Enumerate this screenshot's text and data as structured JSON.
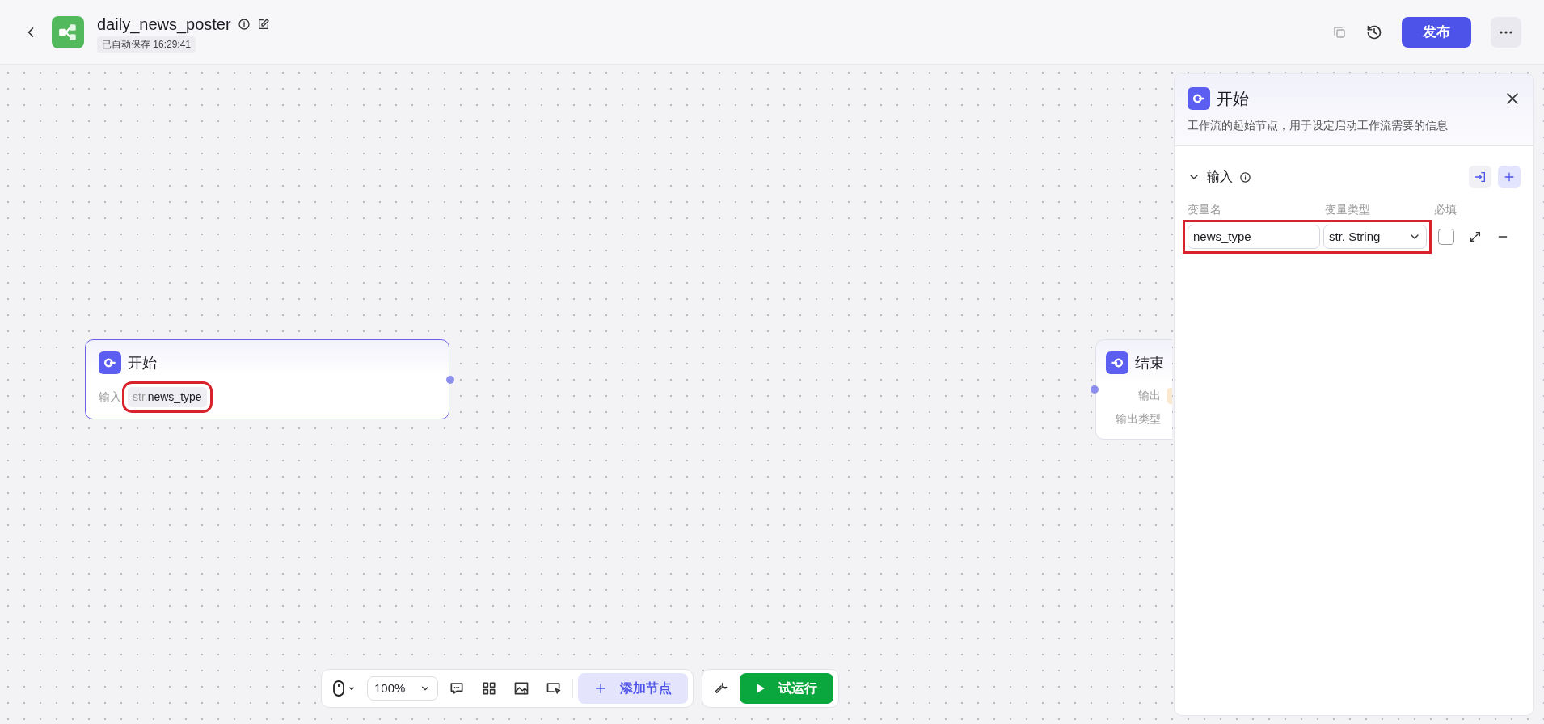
{
  "header": {
    "title": "daily_news_poster",
    "autosave": "已自动保存 16:29:41",
    "publish_button": "发布"
  },
  "nodes": [
    {
      "kind": "start",
      "title": "开始",
      "rows": [
        {
          "label": "输入",
          "type_prefix": "str.",
          "value": "news_type",
          "highlighted": true
        }
      ]
    },
    {
      "kind": "end",
      "title": "结束",
      "rows": [
        {
          "label": "输出"
        },
        {
          "label": "输出类型"
        }
      ]
    }
  ],
  "panel": {
    "title": "开始",
    "description": "工作流的起始节点，用于设定启动工作流需要的信息",
    "section": {
      "title": "输入",
      "expanded": true,
      "columns": [
        "变量名",
        "变量类型",
        "必填"
      ],
      "rows": [
        {
          "name": "news_type",
          "type": "str. String",
          "required": false,
          "highlighted": true
        }
      ]
    }
  },
  "toolbar": {
    "zoom": "100%",
    "add_node": "添加节点",
    "run": "试运行"
  }
}
